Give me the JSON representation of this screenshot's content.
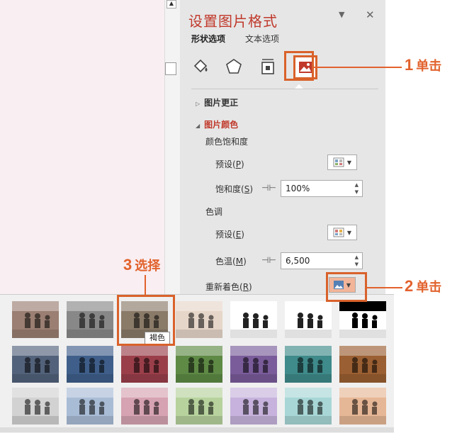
{
  "panel": {
    "title": "设置图片格式",
    "tabs": [
      "形状选项",
      "文本选项"
    ],
    "icons": [
      "fill-line-icon",
      "effects-icon",
      "size-properties-icon",
      "picture-icon"
    ]
  },
  "sections": {
    "correction": "图片更正",
    "color": "图片颜色",
    "saturation": "颜色饱和度",
    "preset1": "预设",
    "preset1_key": "P",
    "saturation_label": "饱和度",
    "saturation_key": "S",
    "saturation_value": "100%",
    "tone": "色调",
    "preset2": "预设",
    "preset2_key": "E",
    "temperature_label": "色温",
    "temperature_key": "M",
    "temperature_value": "6,500",
    "recolor": "重新着色",
    "recolor_key": "R"
  },
  "gallery": {
    "tooltip": "褐色",
    "selected_index": 2,
    "rows": [
      [
        "#9a7f72",
        "#888888",
        "#8a7a68",
        "#e6d6c9",
        "#ffffff",
        "#ffffff",
        "#000000"
      ],
      [
        "#52627a",
        "#3f5f8a",
        "#9a3f4a",
        "#5e8a45",
        "#7a5c9a",
        "#3f8a8a",
        "#9a5f32"
      ],
      [
        "#d2d2d2",
        "#a9bcd6",
        "#d6a3b2",
        "#b7d29d",
        "#c6b2dc",
        "#a8d6d6",
        "#e6b796"
      ]
    ]
  },
  "callouts": {
    "c1_num": "1",
    "c1_text": "单击",
    "c2_num": "2",
    "c2_text": "单击",
    "c3_num": "3",
    "c3_text": "选择"
  },
  "colors": {
    "accent": "#e2622d",
    "title": "#c0392b",
    "panel_bg": "#e6e6e6",
    "slide_bg": "#f9eef2"
  }
}
